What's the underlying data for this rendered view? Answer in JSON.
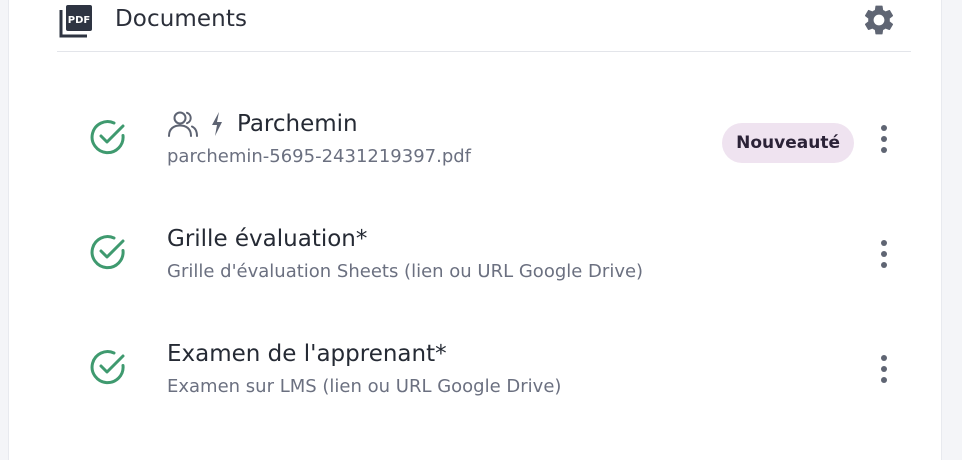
{
  "header": {
    "title": "Documents",
    "pdf_icon_text": "PDF"
  },
  "documents": [
    {
      "name": "Parchemin",
      "subtitle": "parchemin-5695-2431219397.pdf",
      "badge": "Nouveauté",
      "icons": [
        "group-users-icon",
        "lightning-icon"
      ],
      "status": "validated"
    },
    {
      "name": "Grille évaluation*",
      "subtitle": "Grille d'évaluation Sheets (lien ou URL Google Drive)",
      "status": "validated"
    },
    {
      "name": "Examen de l'apprenant*",
      "subtitle": "Examen sur LMS (lien ou URL Google Drive)",
      "status": "validated"
    }
  ],
  "colors": {
    "check": "#3f9a6f",
    "badge_bg": "#efe3f0",
    "icon": "#3a3f4c",
    "title": "#2b2f3a",
    "subtitle": "#6b7080"
  }
}
